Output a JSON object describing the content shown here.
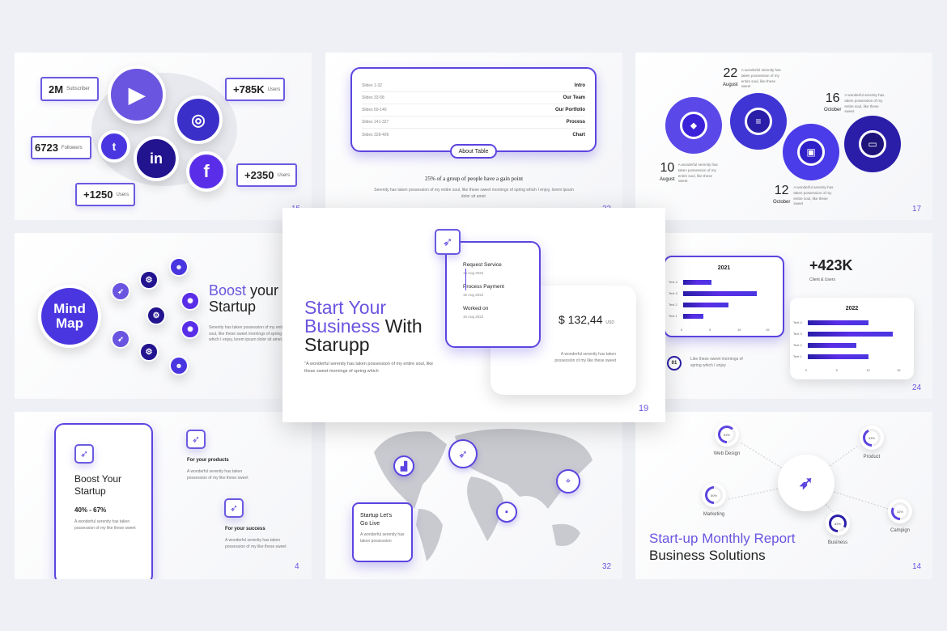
{
  "colors": {
    "accent": "#6a55e0",
    "dark": "#2a12a8",
    "mid": "#4a36e0"
  },
  "social": {
    "page": "15",
    "stats": [
      {
        "value": "2M",
        "unit": "Subscriber"
      },
      {
        "value": "+785K",
        "unit": "Users"
      },
      {
        "value": "6723",
        "unit": "Followers"
      },
      {
        "value": "+2350",
        "unit": "Users"
      },
      {
        "value": "+1250",
        "unit": "Users"
      }
    ],
    "icons": [
      "youtube-icon",
      "instagram-icon",
      "twitter-icon",
      "linkedin-icon",
      "facebook-icon"
    ]
  },
  "table": {
    "page": "33",
    "rows": [
      {
        "range": "Slides 1-32",
        "label": "Intro"
      },
      {
        "range": "Slides 33-58",
        "label": "Our Team"
      },
      {
        "range": "Slides 59-140",
        "label": "Our Portfolio"
      },
      {
        "range": "Slides 141-327",
        "label": "Process"
      },
      {
        "range": "Slides 328-406",
        "label": "Chart"
      }
    ],
    "button": "About Table",
    "heading": "25% of a group of people have a gain point",
    "text": "Serenity has taken possession of my entire soul, like these sweet mornings of spring which I enjoy, lorem ipsum dolor sit amet."
  },
  "gears": {
    "page": "17",
    "dates": [
      {
        "day": "22",
        "month": "August",
        "text": "A wonderful serenity has taken possession of my entire soul, like these sweet"
      },
      {
        "day": "16",
        "month": "October",
        "text": "A wonderful serenity has taken possession of my entire soul, like these sweet"
      },
      {
        "day": "10",
        "month": "August",
        "text": "A wonderful serenity has taken possession of my entire soul, like these sweet"
      },
      {
        "day": "12",
        "month": "October",
        "text": "A wonderful serenity has taken possession of my entire soul, like these sweet"
      }
    ]
  },
  "mindmap": {
    "circle_line1": "Mind",
    "circle_line2": "Map",
    "title_accent": "Boost",
    "title_rest": " your",
    "title_line2": "Startup",
    "text": "Serenity has taken possession of my entire soul, like these sweet mornings of spring which I enjoy, lorem ipsum dolor sit amet."
  },
  "hero": {
    "page": "19",
    "title_accent1": "Start Your",
    "title_accent2": "Business",
    "title_rest": " With",
    "title_line3": "Starupp",
    "text": "\"A wonderful serenity has taken possession of my entire soul, like these sweet mornings of spring which",
    "steps": [
      {
        "label": "Request Service",
        "date": "16 Aug 2022"
      },
      {
        "label": "Process Payment",
        "date": "16 Aug 2022"
      },
      {
        "label": "Worked on",
        "date": "16 Aug 2022"
      }
    ],
    "price": "$ 132,44",
    "currency": "USD",
    "price_text": "A wonderful serenity has taken possession of my like these sweet"
  },
  "bars": {
    "page": "24",
    "stat": "+423K",
    "stat_label": "Client & Users",
    "badge": "01",
    "badge_text": "Like these sweet mornings of spring which I enjoy"
  },
  "chart_data": [
    {
      "type": "bar",
      "orientation": "horizontal",
      "title": "2021",
      "categories": [
        "Text 4",
        "Text 3",
        "Text 2",
        "Text 1"
      ],
      "values": [
        5,
        13,
        8,
        3.5
      ],
      "xlim": [
        0,
        15
      ],
      "ticks": [
        "0",
        "5",
        "10",
        "15"
      ]
    },
    {
      "type": "bar",
      "orientation": "horizontal",
      "title": "2022",
      "categories": [
        "Text 4",
        "Text 3",
        "Text 2",
        "Text 1"
      ],
      "values": [
        10,
        14,
        8,
        10
      ],
      "xlim": [
        0,
        15
      ],
      "ticks": [
        "0",
        "5",
        "10",
        "15"
      ]
    }
  ],
  "boost": {
    "page": "4",
    "title": "Boost Your Startup",
    "range": "40% - 67%",
    "text": "A wonderful serenity has taken possession of my like these sweet",
    "items": [
      {
        "title": "For your products",
        "text": "A wonderful serenity has taken possession of my like these sweet"
      },
      {
        "title": "For your success",
        "text": "A wonderful serenity has taken possession of my like these sweet"
      }
    ]
  },
  "map": {
    "page": "32",
    "card_title": "Startup Let's Go Live",
    "card_text": "A wonderful serenity has taken possession"
  },
  "report": {
    "page": "14",
    "title_line1": "Start-up Monthly Report",
    "title_line2": "Business Solutions",
    "items": [
      {
        "label": "Web Design",
        "percent": 63
      },
      {
        "label": "Product",
        "percent": 43
      },
      {
        "label": "Marketing",
        "percent": 50
      },
      {
        "label": "Business",
        "percent": 83
      },
      {
        "label": "Campign",
        "percent": 32
      }
    ]
  }
}
